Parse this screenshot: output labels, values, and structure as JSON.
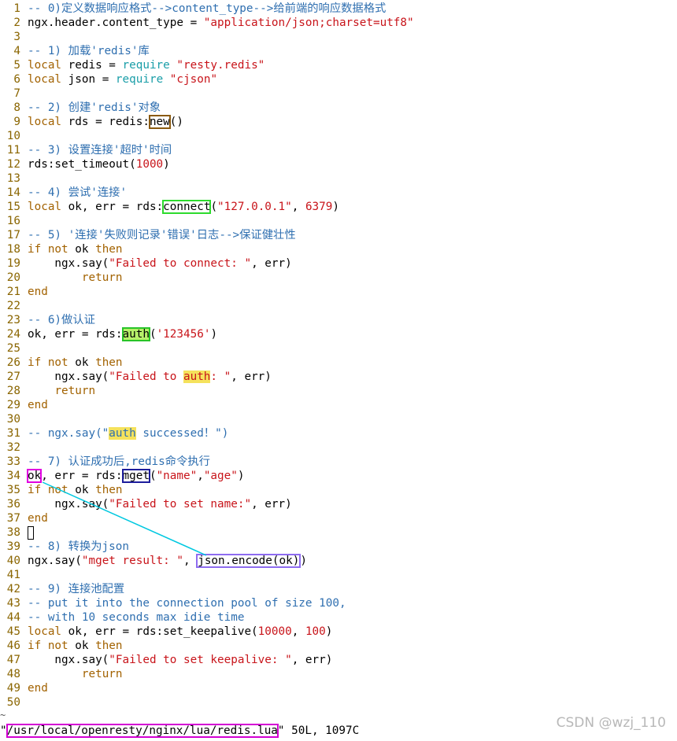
{
  "editor": {
    "lines": [
      {
        "n": "1",
        "segs": [
          {
            "t": "-- 0)定义数据响应格式-->content_type-->给前端的响应数据格式",
            "c": "c"
          }
        ]
      },
      {
        "n": "2",
        "segs": [
          {
            "t": "ngx.header.content_type = "
          },
          {
            "t": "\"application/json;charset=utf8\"",
            "c": "s"
          }
        ]
      },
      {
        "n": "3",
        "segs": []
      },
      {
        "n": "4",
        "segs": [
          {
            "t": "-- 1) 加载'redis'库",
            "c": "c"
          }
        ]
      },
      {
        "n": "5",
        "segs": [
          {
            "t": "local",
            "c": "k"
          },
          {
            "t": " redis = "
          },
          {
            "t": "require",
            "c": "b"
          },
          {
            "t": " "
          },
          {
            "t": "\"resty.redis\"",
            "c": "s"
          }
        ]
      },
      {
        "n": "6",
        "segs": [
          {
            "t": "local",
            "c": "k"
          },
          {
            "t": " json = "
          },
          {
            "t": "require",
            "c": "b"
          },
          {
            "t": " "
          },
          {
            "t": "\"cjson\"",
            "c": "s"
          }
        ]
      },
      {
        "n": "7",
        "segs": []
      },
      {
        "n": "8",
        "segs": [
          {
            "t": "-- 2) 创建'redis'对象",
            "c": "c"
          }
        ]
      },
      {
        "n": "9",
        "segs": [
          {
            "t": "local",
            "c": "k"
          },
          {
            "t": " rds = redis:"
          },
          {
            "t": "new",
            "box": "box-brown"
          },
          {
            "t": "()"
          }
        ]
      },
      {
        "n": "10",
        "segs": []
      },
      {
        "n": "11",
        "segs": [
          {
            "t": "-- 3) 设置连接'超时'时间",
            "c": "c"
          }
        ]
      },
      {
        "n": "12",
        "segs": [
          {
            "t": "rds:set_timeout("
          },
          {
            "t": "1000",
            "c": "n"
          },
          {
            "t": ")"
          }
        ]
      },
      {
        "n": "13",
        "segs": []
      },
      {
        "n": "14",
        "segs": [
          {
            "t": "-- 4) 尝试'连接'",
            "c": "c"
          }
        ]
      },
      {
        "n": "15",
        "segs": [
          {
            "t": "local",
            "c": "k"
          },
          {
            "t": " ok, err = rds:"
          },
          {
            "t": "connect",
            "box": "box-green"
          },
          {
            "t": "("
          },
          {
            "t": "\"127.0.0.1\"",
            "c": "s"
          },
          {
            "t": ", "
          },
          {
            "t": "6379",
            "c": "n"
          },
          {
            "t": ")"
          }
        ]
      },
      {
        "n": "16",
        "segs": []
      },
      {
        "n": "17",
        "segs": [
          {
            "t": "-- 5) '连接'失败则记录'错误'日志-->保证健壮性",
            "c": "c"
          }
        ]
      },
      {
        "n": "18",
        "segs": [
          {
            "t": "if not",
            "c": "k"
          },
          {
            "t": " ok "
          },
          {
            "t": "then",
            "c": "k"
          }
        ]
      },
      {
        "n": "19",
        "segs": [
          {
            "t": "    ngx.say("
          },
          {
            "t": "\"Failed to connect: \"",
            "c": "s"
          },
          {
            "t": ", err)"
          }
        ]
      },
      {
        "n": "20",
        "segs": [
          {
            "t": "        "
          },
          {
            "t": "return",
            "c": "k"
          }
        ]
      },
      {
        "n": "21",
        "segs": [
          {
            "t": "end",
            "c": "k"
          }
        ]
      },
      {
        "n": "22",
        "segs": []
      },
      {
        "n": "23",
        "segs": [
          {
            "t": "-- 6)做认证",
            "c": "c"
          }
        ]
      },
      {
        "n": "24",
        "segs": [
          {
            "t": "ok, err = rds:"
          },
          {
            "t": "auth",
            "box": "box-green2 hl-green"
          },
          {
            "t": "("
          },
          {
            "t": "'123456'",
            "c": "s"
          },
          {
            "t": ")"
          }
        ]
      },
      {
        "n": "25",
        "segs": []
      },
      {
        "n": "26",
        "segs": [
          {
            "t": "if not",
            "c": "k"
          },
          {
            "t": " ok "
          },
          {
            "t": "then",
            "c": "k"
          }
        ]
      },
      {
        "n": "27",
        "segs": [
          {
            "t": "    ngx.say("
          },
          {
            "t": "\"Failed to ",
            "c": "s"
          },
          {
            "t": "auth",
            "c": "s",
            "box": "hl-yellow"
          },
          {
            "t": ": \"",
            "c": "s"
          },
          {
            "t": ", err)"
          }
        ]
      },
      {
        "n": "28",
        "segs": [
          {
            "t": "    "
          },
          {
            "t": "return",
            "c": "k"
          }
        ]
      },
      {
        "n": "29",
        "segs": [
          {
            "t": "end",
            "c": "k"
          }
        ]
      },
      {
        "n": "30",
        "segs": []
      },
      {
        "n": "31",
        "segs": [
          {
            "t": "-- ngx.say(\"",
            "c": "c"
          },
          {
            "t": "auth",
            "c": "c",
            "box": "hl-yellow"
          },
          {
            "t": " successed！\")",
            "c": "c"
          }
        ]
      },
      {
        "n": "32",
        "segs": []
      },
      {
        "n": "33",
        "segs": [
          {
            "t": "-- 7) 认证成功后,redis命令执行",
            "c": "c"
          }
        ]
      },
      {
        "n": "34",
        "segs": [
          {
            "t": "ok",
            "box": "box-magenta"
          },
          {
            "t": ", err = rds:"
          },
          {
            "t": "mget",
            "box": "box-navy"
          },
          {
            "t": "("
          },
          {
            "t": "\"name\"",
            "c": "s"
          },
          {
            "t": ","
          },
          {
            "t": "\"age\"",
            "c": "s"
          },
          {
            "t": ")"
          }
        ]
      },
      {
        "n": "35",
        "segs": [
          {
            "t": "if not",
            "c": "k"
          },
          {
            "t": " ok "
          },
          {
            "t": "then",
            "c": "k"
          }
        ]
      },
      {
        "n": "36",
        "segs": [
          {
            "t": "    ngx.say("
          },
          {
            "t": "\"Failed to set name:\"",
            "c": "s"
          },
          {
            "t": ", err)"
          }
        ]
      },
      {
        "n": "37",
        "segs": [
          {
            "t": "end",
            "c": "k"
          }
        ]
      },
      {
        "n": "38",
        "segs": [],
        "cursor": true
      },
      {
        "n": "39",
        "segs": [
          {
            "t": "-- 8) 转换为json",
            "c": "c"
          }
        ]
      },
      {
        "n": "40",
        "segs": [
          {
            "t": "ngx.say("
          },
          {
            "t": "\"mget result: \"",
            "c": "s"
          },
          {
            "t": ", "
          },
          {
            "t": "json.encode(ok)",
            "box": "box-violet"
          },
          {
            "t": ")"
          }
        ]
      },
      {
        "n": "41",
        "segs": []
      },
      {
        "n": "42",
        "segs": [
          {
            "t": "-- 9) 连接池配置",
            "c": "c"
          }
        ]
      },
      {
        "n": "43",
        "segs": [
          {
            "t": "-- put it into the connection pool of size 100,",
            "c": "c"
          }
        ]
      },
      {
        "n": "44",
        "segs": [
          {
            "t": "-- with 10 seconds max idie time",
            "c": "c"
          }
        ]
      },
      {
        "n": "45",
        "segs": [
          {
            "t": "local",
            "c": "k"
          },
          {
            "t": " ok, err = rds:set_keepalive("
          },
          {
            "t": "10000",
            "c": "n"
          },
          {
            "t": ", "
          },
          {
            "t": "100",
            "c": "n"
          },
          {
            "t": ")"
          }
        ]
      },
      {
        "n": "46",
        "segs": [
          {
            "t": "if not",
            "c": "k"
          },
          {
            "t": " ok "
          },
          {
            "t": "then",
            "c": "k"
          }
        ]
      },
      {
        "n": "47",
        "segs": [
          {
            "t": "    ngx.say("
          },
          {
            "t": "\"Failed to set keepalive: \"",
            "c": "s"
          },
          {
            "t": ", err)"
          }
        ]
      },
      {
        "n": "48",
        "segs": [
          {
            "t": "        "
          },
          {
            "t": "return",
            "c": "k"
          }
        ]
      },
      {
        "n": "49",
        "segs": [
          {
            "t": "end",
            "c": "k"
          }
        ]
      },
      {
        "n": "50",
        "segs": []
      }
    ]
  },
  "statusbar": {
    "quote_open": "\"",
    "path": "/usr/local/openresty/nginx/lua/redis.lua",
    "info": "\" 50L, 1097C"
  },
  "tilde": "~",
  "watermark": "CSDN @wzj_110",
  "colors": {
    "comment": "#2f6fb0",
    "keyword": "#a26200",
    "string": "#c8141a",
    "builtin": "#1a9ea8",
    "highlight_yellow": "#f5e25c",
    "highlight_green": "#b7f06a",
    "arrow": "#00c8e0"
  }
}
